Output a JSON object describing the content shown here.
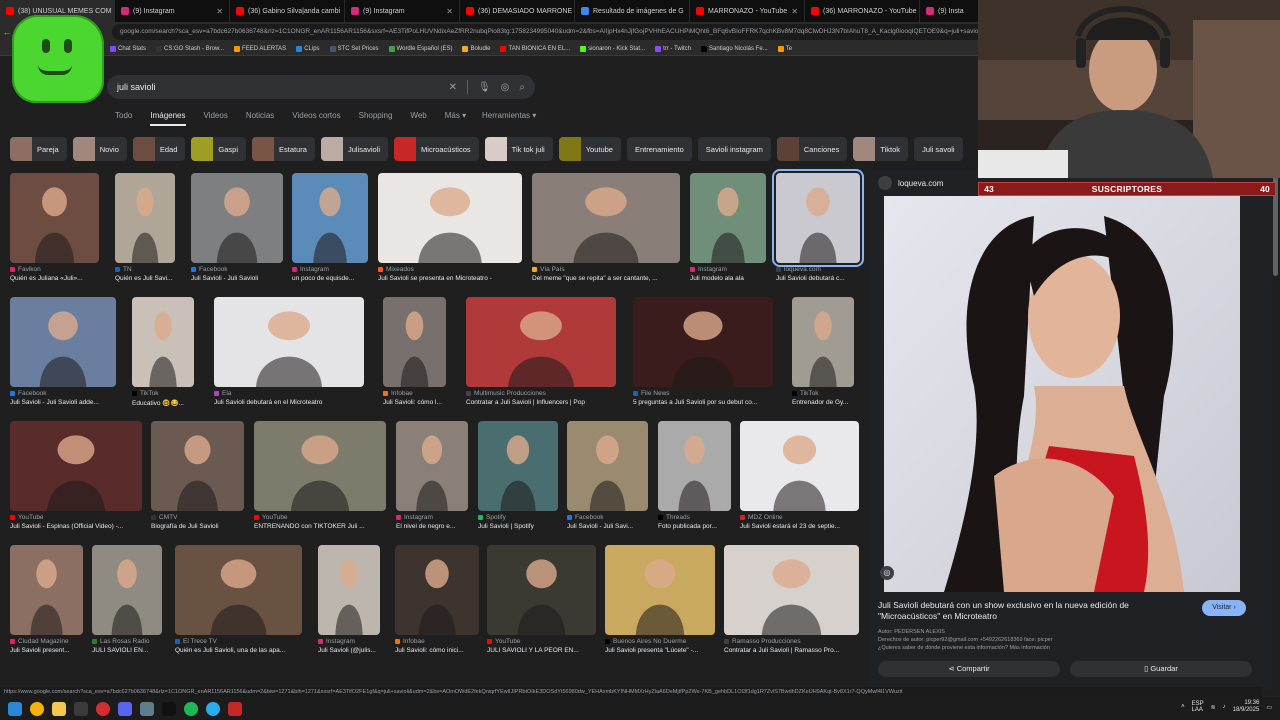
{
  "tabs": [
    {
      "label": "(38) UNUSUAL MEMES COM",
      "color": "#ff0000",
      "active": true
    },
    {
      "label": "(9) Instagram",
      "color": "#d62976"
    },
    {
      "label": "(36) Gabino Silva|anda cambi",
      "color": "#ff0000"
    },
    {
      "label": "(9) Instagram",
      "color": "#d62976"
    },
    {
      "label": "(36) DEMASIADO MARRONE",
      "color": "#ff0000"
    },
    {
      "label": "Resultado de imágenes de G",
      "color": "#4285f4"
    },
    {
      "label": "MARRONAZO - YouTube",
      "color": "#ff0000"
    },
    {
      "label": "(36) MARRONAZO - YouTube",
      "color": "#ff0000"
    },
    {
      "label": "(9) Insta",
      "color": "#d62976"
    }
  ],
  "address": "google.com/search?sca_esv=a7bdc627b0636748&rlz=1C1ONGR_enAR1156AR1156&sxsrf=AE3TifPoLHUVNdixAeZfRR2nubqPio83tg:1758234995040&udm=2&fbs=AIIjpHx4nJjfGojPVHhEACUHPiMQht6_BFq6vBIoFFRK7qchKBv8M7dq8ClwDHJ3N7bIAhuT8_A_Kaclg0iooqIQETOE9&q=juli+savioli",
  "bookmarks": [
    {
      "label": "Chat Stats",
      "color": "#7c4dff"
    },
    {
      "label": "CS:GO Stash - Brow...",
      "color": "#333333"
    },
    {
      "label": "FEED ALERTAS",
      "color": "#ff9800"
    },
    {
      "label": "CLips",
      "color": "#1e88e5"
    },
    {
      "label": "STC Set Prices",
      "color": "#455a64"
    },
    {
      "label": "Wordle Español (ES)",
      "color": "#43a047"
    },
    {
      "label": "Boludle",
      "color": "#f9a825"
    },
    {
      "label": "TAN BIONICA EN EL...",
      "color": "#ff0000"
    },
    {
      "label": "sionaron - Kick Stat...",
      "color": "#53fc18"
    },
    {
      "label": "trr - Twitch",
      "color": "#9146ff"
    },
    {
      "label": "Santiago Nicolás Fe...",
      "color": "#000000"
    },
    {
      "label": "Te",
      "color": "#ff9800"
    }
  ],
  "search": {
    "query": "juli savioli"
  },
  "result_tabs": [
    "Todo",
    "Imágenes",
    "Videos",
    "Noticias",
    "Videos cortos",
    "Shopping",
    "Web",
    "Más ▾"
  ],
  "tools_label": "Herramientas ▾",
  "chips": [
    {
      "label": "Pareja",
      "color": "#8d6e63"
    },
    {
      "label": "Novio",
      "color": "#a1887f"
    },
    {
      "label": "Edad",
      "color": "#6d4c41"
    },
    {
      "label": "Gaspi",
      "color": "#9e9d24"
    },
    {
      "label": "Estatura",
      "color": "#795548"
    },
    {
      "label": "Julisavioli",
      "color": "#bcaaa4"
    },
    {
      "label": "Microacústicos",
      "color": "#c62828"
    },
    {
      "label": "Tik tok juli",
      "color": "#d7ccc8"
    },
    {
      "label": "Youtube",
      "color": "#827717"
    },
    {
      "label": "Entrenamiento",
      "color": ""
    },
    {
      "label": "Savioli instagram",
      "color": ""
    },
    {
      "label": "Canciones",
      "color": "#5d4037"
    },
    {
      "label": "Tiktok",
      "color": "#a1887f"
    },
    {
      "label": "Juli savoli",
      "color": ""
    }
  ],
  "rows": [
    [
      {
        "src": "Favikon",
        "title": "Quién es Juliana «Juli»...",
        "color": "#6d4c41",
        "srcColor": "#e91e63"
      },
      {
        "src": "TN",
        "title": "Quién es Juli Savi...",
        "color": "#b0a698",
        "srcColor": "#1565c0"
      },
      {
        "src": "Facebook",
        "title": "Juli Savioli - Juli Savioli",
        "color": "#7d7f80",
        "srcColor": "#1877f2"
      },
      {
        "src": "Instagram",
        "title": "un poco de equisde...",
        "color": "#5b8bb8",
        "srcColor": "#d62976"
      },
      {
        "src": "Mixeados",
        "title": "Juli Savioli se presenta en Microteatro -",
        "color": "#e9e6e3",
        "srcColor": "#ff5722"
      },
      {
        "src": "Vía País",
        "title": "Del meme \"que se repita\" a ser cantante, ...",
        "color": "#8a7f78",
        "srcColor": "#f9a825"
      },
      {
        "src": "Instagram",
        "title": "Juli modelo ala ala",
        "color": "#6f8f7a",
        "srcColor": "#d62976"
      },
      {
        "src": "loqueva.com",
        "title": "Juli Savioli debutará c...",
        "color": "#c9c9cf",
        "srcColor": "#3c4043"
      }
    ],
    [
      {
        "src": "Facebook",
        "title": "Juli Savioli - Juli Savioli adde...",
        "color": "#6a7ea0",
        "srcColor": "#1877f2"
      },
      {
        "src": "TikTok",
        "title": "Educativo 🤓😂...",
        "color": "#c9c1b8",
        "srcColor": "#000000"
      },
      {
        "src": "Ela",
        "title": "Juli Savioli debutará en el Microteatro",
        "color": "#e4e3e6",
        "srcColor": "#ab47bc"
      },
      {
        "src": "Infobae",
        "title": "Juli Savioli: cómo l...",
        "color": "#77706c",
        "srcColor": "#ff6f00"
      },
      {
        "src": "Multimusic Producciones",
        "title": "Contratar a Juli Savioli | Influencers | Pop",
        "color": "#b03a3a",
        "srcColor": "#37474f"
      },
      {
        "src": "File News",
        "title": "5 preguntas a Juli Savioli por su debut co...",
        "color": "#3a1c1c",
        "srcColor": "#1565c0"
      },
      {
        "src": "TikTok",
        "title": "Entrenador de Gy...",
        "color": "#a09b93",
        "srcColor": "#000000"
      }
    ],
    [
      {
        "src": "YouTube",
        "title": "Juli Savioli - Espinas (Official Video) -...",
        "color": "#5a2b2b",
        "srcColor": "#ff0000"
      },
      {
        "src": "CMTV",
        "title": "Biografía de Juli Savioli",
        "color": "#6a5a52",
        "srcColor": "#333333"
      },
      {
        "src": "YouTube",
        "title": "ENTRENANDO con TIKTOKER Juli ...",
        "color": "#7d7b6c",
        "srcColor": "#ff0000"
      },
      {
        "src": "Instagram",
        "title": "El nivel de negro e...",
        "color": "#8a8078",
        "srcColor": "#d62976"
      },
      {
        "src": "Spotify",
        "title": "Juli Savioli | Spotify",
        "color": "#4a6e6f",
        "srcColor": "#1db954"
      },
      {
        "src": "Facebook",
        "title": "Juli Savioli - Juli Savi...",
        "color": "#9a8a70",
        "srcColor": "#1877f2"
      },
      {
        "src": "Threads",
        "title": "Foto publicada por...",
        "color": "#aaaaaa",
        "srcColor": "#000000"
      },
      {
        "src": "MDZ Online",
        "title": "Juli Savioli estará el 23 de septie...",
        "color": "#e9e9ec",
        "srcColor": "#c62828"
      }
    ],
    [
      {
        "src": "Ciudad Magazine",
        "title": "Juli Savioli present...",
        "color": "#8c6f63",
        "srcColor": "#e91e63"
      },
      {
        "src": "Las Rosas Radio",
        "title": "JULI SAVIOLI EN...",
        "color": "#8f8a82",
        "srcColor": "#2e7d32"
      },
      {
        "src": "El Trece TV",
        "title": "Quién es Juli Savioli, una de las apa...",
        "color": "#6a5243",
        "srcColor": "#1565c0"
      },
      {
        "src": "Instagram",
        "title": "Juli Savioli (@julis...",
        "color": "#bdb6ae",
        "srcColor": "#d62976"
      },
      {
        "src": "Infobae",
        "title": "Juli Savioli: cómo inici...",
        "color": "#3d342f",
        "srcColor": "#ff6f00"
      },
      {
        "src": "YouTube",
        "title": "JULI SAVIOLI Y LA PEOR EN...",
        "color": "#3a3a32",
        "srcColor": "#ff0000"
      },
      {
        "src": "Buenos Aires No Duerme",
        "title": "Juli Savioli presenta \"Lúcete\" -...",
        "color": "#c9a860",
        "srcColor": "#000000"
      },
      {
        "src": "Ramasso Producciones",
        "title": "Contratar a Juli Savioli | Ramasso Pro...",
        "color": "#d6d1cc",
        "srcColor": "#3c4043"
      }
    ]
  ],
  "preview": {
    "source": "loqueva.com",
    "title": "Juli Savioli debutará con un show exclusivo en la nueva edición de \"Microacústicos\" en Microteatro",
    "visit_label": "Visitar ›",
    "author": "Autor: PEDERSEN ALEXIS",
    "rights": "Derechos de autor: picper92@gmail.com +5492262618369 face: picper",
    "more": "¿Quieres saber de dónde proviene esta información? Más información",
    "share_label": "⋖ Compartir",
    "save_label": "▯ Guardar"
  },
  "subscribers": {
    "left": "43",
    "label": "SUSCRIPTORES",
    "right": "40"
  },
  "status_url": "https://www.google.com/search?sca_esv=a7bdc627b0636748&rlz=1C1ONGR_enAR1156AR1156&udm=2&biw=1271&bih=1271&sxsrf=AE3TifO2FE1gf&q=juli+savioli&udm=2&bs=AOmOWdE2fekQniqrfYEwlIJIPRbtOIkE3DOSdYt56980dw_YEHAxmbKYINHMMXrHyZlaA6DeMjtfPp2We-7KB_gehbDL1OI3f1dg1R7ZvlS7BwdhDZKeUH9AKqt-Bv8X1r7-QQyMwf4l1VWuzit",
  "tray": {
    "lang": "ESP\nLAA",
    "time": "19:36",
    "date": "18/9/2025"
  }
}
